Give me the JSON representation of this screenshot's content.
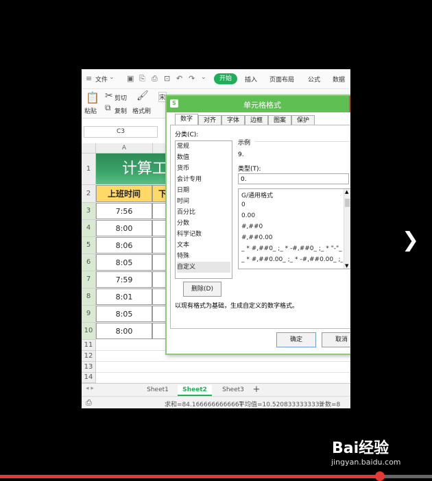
{
  "menu": {
    "file": "文件",
    "tabs": [
      "开始",
      "插入",
      "页面布局",
      "公式",
      "数据"
    ],
    "active_tab": "开始"
  },
  "ribbon": {
    "paste": "粘贴",
    "cut": "剪切",
    "copy": "复制",
    "format_painter": "格式刷",
    "font_partial": "宋"
  },
  "formula_bar": {
    "cell_ref": "C3"
  },
  "sheet": {
    "column_headers": [
      "A"
    ],
    "row_numbers": [
      "1",
      "2",
      "3",
      "4",
      "5",
      "6",
      "7",
      "8",
      "9",
      "10",
      "11",
      "12",
      "13",
      "14"
    ],
    "title_text": "计算工",
    "header_a": "上班时间",
    "header_b": "下",
    "times": [
      "7:56",
      "8:00",
      "8:06",
      "8:05",
      "7:59",
      "8:01",
      "8:05",
      "8:00"
    ]
  },
  "sheet_tabs": [
    "Sheet1",
    "Sheet2",
    "Sheet3"
  ],
  "active_sheet": "Sheet2",
  "status": {
    "sum": "求和=84.1666666666667",
    "avg": "平均值=10.5208333333333",
    "count": "计数=8"
  },
  "dialog": {
    "title": "单元格格式",
    "tabs": [
      "数字",
      "对齐",
      "字体",
      "边框",
      "图案",
      "保护"
    ],
    "active_tab": "数字",
    "category_label": "分类(C):",
    "categories": [
      "常规",
      "数值",
      "货币",
      "会计专用",
      "日期",
      "时间",
      "百分比",
      "分数",
      "科学记数",
      "文本",
      "特殊",
      "自定义"
    ],
    "selected_category": "自定义",
    "sample_label": "示例",
    "sample_value": "9.",
    "type_label": "类型(T):",
    "type_value": "0.",
    "type_list": [
      "G/通用格式",
      "0",
      "0.00",
      "#,##0",
      "#,##0.00",
      "_ * #,##0_ ;_ * -#,##0_ ;_ * \"-\"_ ;_ @_",
      "_ * #,##0.00_ ;_ * -#,##0.00_ ;_ * \"-\"??_ ;_ @_"
    ],
    "delete_button": "删除(D)",
    "description": "以现有格式为基础，生成自定义的数字格式。",
    "ok": "确定",
    "cancel": "取消"
  },
  "watermark": {
    "brand": "Bai经验",
    "url": "jingyan.baidu.com"
  },
  "video_progress": 0.88
}
